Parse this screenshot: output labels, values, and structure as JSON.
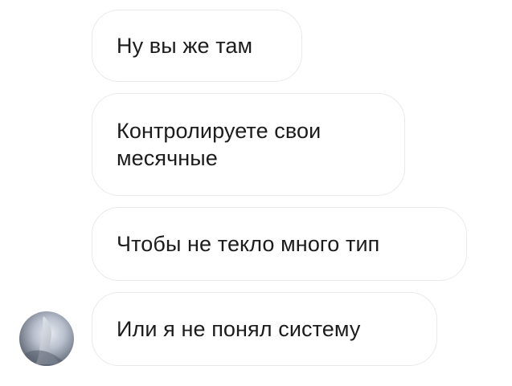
{
  "messages": [
    {
      "text": "Ну вы же там"
    },
    {
      "text": "Контролируете свои\nмесячные"
    },
    {
      "text": "Чтобы не текло много тип"
    },
    {
      "text": "Или я не понял систему"
    }
  ],
  "sender": {
    "avatar_icon": "user-avatar-photo"
  },
  "colors": {
    "background": "#ffffff",
    "bubble_border": "#e9e9e9",
    "text": "#1c1c1c"
  }
}
